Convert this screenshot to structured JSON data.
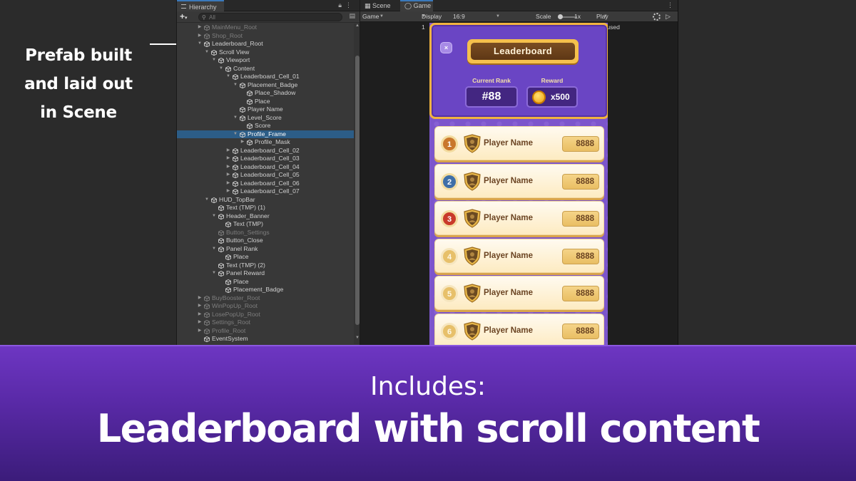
{
  "callout": {
    "line1": "Prefab built",
    "line2": "and laid out",
    "line3": "in Scene"
  },
  "hierarchy": {
    "tab_label": "Hierarchy",
    "search_placeholder": "All",
    "add_button": "+",
    "items": [
      {
        "label": "MainMenu_Root",
        "dim": true,
        "arrow": "right"
      },
      {
        "label": "Shop_Root",
        "dim": true,
        "arrow": "right"
      },
      {
        "label": "Leaderboard_Root",
        "dim": false,
        "arrow": "down"
      },
      {
        "label": "Scroll View",
        "dim": false,
        "arrow": "down"
      },
      {
        "label": "Viewport",
        "dim": false,
        "arrow": "down"
      },
      {
        "label": "Content",
        "dim": false,
        "arrow": "down"
      },
      {
        "label": "Leaderboard_Cell_01",
        "dim": false,
        "arrow": "down"
      },
      {
        "label": "Placement_Badge",
        "dim": false,
        "arrow": "down"
      },
      {
        "label": "Place_Shadow",
        "dim": false,
        "arrow": ""
      },
      {
        "label": "Place",
        "dim": false,
        "arrow": ""
      },
      {
        "label": "Player Name",
        "dim": false,
        "arrow": ""
      },
      {
        "label": "Level_Score",
        "dim": false,
        "arrow": "down"
      },
      {
        "label": "Score",
        "dim": false,
        "arrow": ""
      },
      {
        "label": "Profile_Frame",
        "dim": false,
        "arrow": "down",
        "selected": true
      },
      {
        "label": "Profile_Mask",
        "dim": false,
        "arrow": "right"
      },
      {
        "label": "Leaderboard_Cell_02",
        "dim": false,
        "arrow": "right"
      },
      {
        "label": "Leaderboard_Cell_03",
        "dim": false,
        "arrow": "right"
      },
      {
        "label": "Leaderboard_Cell_04",
        "dim": false,
        "arrow": "right"
      },
      {
        "label": "Leaderboard_Cell_05",
        "dim": false,
        "arrow": "right"
      },
      {
        "label": "Leaderboard_Cell_06",
        "dim": false,
        "arrow": "right"
      },
      {
        "label": "Leaderboard_Cell_07",
        "dim": false,
        "arrow": "right"
      },
      {
        "label": "HUD_TopBar",
        "dim": false,
        "arrow": "down"
      },
      {
        "label": "Text (TMP) (1)",
        "dim": false,
        "arrow": ""
      },
      {
        "label": "Header_Banner",
        "dim": false,
        "arrow": "down"
      },
      {
        "label": "Text (TMP)",
        "dim": false,
        "arrow": ""
      },
      {
        "label": "Button_Settings",
        "dim": true,
        "arrow": ""
      },
      {
        "label": "Button_Close",
        "dim": false,
        "arrow": ""
      },
      {
        "label": "Panel Rank",
        "dim": false,
        "arrow": "down"
      },
      {
        "label": "Place",
        "dim": false,
        "arrow": ""
      },
      {
        "label": "Text (TMP) (2)",
        "dim": false,
        "arrow": ""
      },
      {
        "label": "Panel Reward",
        "dim": false,
        "arrow": "down"
      },
      {
        "label": "Place",
        "dim": false,
        "arrow": ""
      },
      {
        "label": "Placement_Badge",
        "dim": false,
        "arrow": ""
      },
      {
        "label": "BuyBooster_Root",
        "dim": true,
        "arrow": "right"
      },
      {
        "label": "WinPopUp_Root",
        "dim": true,
        "arrow": "right"
      },
      {
        "label": "LosePopUp_Root",
        "dim": true,
        "arrow": "right"
      },
      {
        "label": "Settings_Root",
        "dim": true,
        "arrow": "right"
      },
      {
        "label": "Profile_Root",
        "dim": true,
        "arrow": "right"
      },
      {
        "label": "EventSystem",
        "dim": false,
        "arrow": ""
      }
    ]
  },
  "game_view": {
    "tab_scene": "Scene",
    "tab_game": "Game",
    "toolbar": {
      "mode": "Game",
      "display": "Display 1",
      "aspect": "16:9 Portrait",
      "scale_label": "Scale",
      "scale_value": "1x",
      "play_mode": "Play Focused"
    },
    "leaderboard": {
      "title": "Leaderboard",
      "close_label": "×",
      "current_rank_label": "Current Rank",
      "current_rank_value": "#88",
      "reward_label": "Reward",
      "reward_value": "x500",
      "cells": [
        {
          "place": "1",
          "name": "Player Name",
          "score": "8888",
          "color": "#c9772c"
        },
        {
          "place": "2",
          "name": "Player Name",
          "score": "8888",
          "color": "#3f6fa8"
        },
        {
          "place": "3",
          "name": "Player Name",
          "score": "8888",
          "color": "#c93a2a"
        },
        {
          "place": "4",
          "name": "Player Name",
          "score": "8888",
          "color": "#e7c06a"
        },
        {
          "place": "5",
          "name": "Player Name",
          "score": "8888",
          "color": "#e7c06a"
        },
        {
          "place": "6",
          "name": "Player Name",
          "score": "8888",
          "color": "#e7c06a"
        }
      ]
    }
  },
  "banner": {
    "includes": "Includes:",
    "headline": "Leaderboard with scroll content"
  },
  "colors": {
    "accent_purple": "#6d36c2",
    "gold": "#f0b340",
    "selection": "#2c5d87"
  }
}
